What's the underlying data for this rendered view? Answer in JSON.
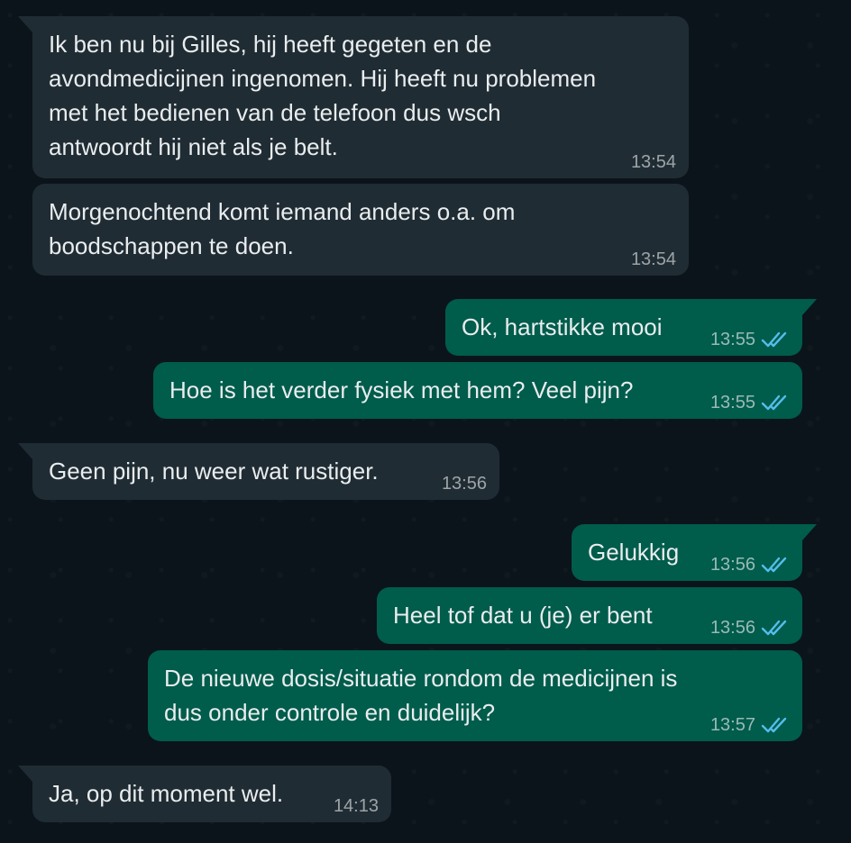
{
  "theme": {
    "background": "#0b141a",
    "incoming_bubble": "#202c33",
    "outgoing_bubble": "#005c4b",
    "text": "#e9edef",
    "read_tick": "#53bdeb"
  },
  "messages": [
    {
      "direction": "incoming",
      "lines": [
        "Ik ben nu bij Gilles, hij heeft gegeten en de",
        "avondmedicijnen ingenomen. Hij heeft nu problemen",
        "met het bedienen van de telefoon dus wsch",
        "antwoordt hij niet als je belt."
      ],
      "time": "13:54"
    },
    {
      "direction": "incoming",
      "lines": [
        "Morgenochtend komt iemand anders o.a. om",
        "boodschappen te doen."
      ],
      "time": "13:54"
    },
    {
      "direction": "outgoing",
      "lines": [
        "Ok, hartstikke mooi"
      ],
      "time": "13:55",
      "status": "read-double-tick-icon"
    },
    {
      "direction": "outgoing",
      "lines": [
        "Hoe is het verder fysiek met hem? Veel pijn?"
      ],
      "time": "13:55",
      "status": "read-double-tick-icon"
    },
    {
      "direction": "incoming",
      "lines": [
        "Geen pijn, nu weer wat rustiger."
      ],
      "time": "13:56"
    },
    {
      "direction": "outgoing",
      "lines": [
        "Gelukkig"
      ],
      "time": "13:56",
      "status": "read-double-tick-icon"
    },
    {
      "direction": "outgoing",
      "lines": [
        "Heel tof dat u (je) er bent"
      ],
      "time": "13:56",
      "status": "read-double-tick-icon"
    },
    {
      "direction": "outgoing",
      "lines": [
        "De nieuwe dosis/situatie rondom de medicijnen is",
        "dus onder controle en duidelijk?"
      ],
      "time": "13:57",
      "status": "read-double-tick-icon"
    },
    {
      "direction": "incoming",
      "lines": [
        "Ja, op dit moment wel."
      ],
      "time": "14:13"
    }
  ]
}
